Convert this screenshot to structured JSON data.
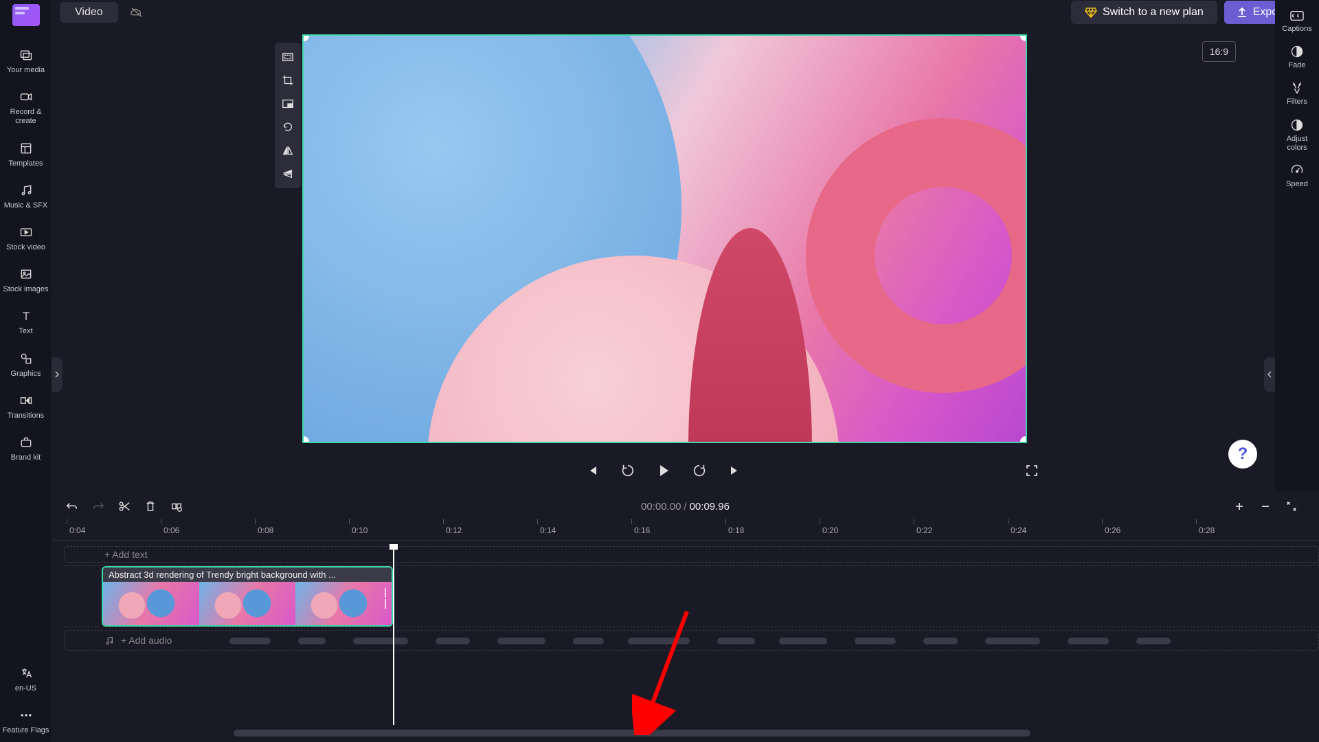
{
  "header": {
    "title_tab": "Video",
    "switch_plan": "Switch to a new plan",
    "export": "Export",
    "aspect_ratio": "16:9"
  },
  "left_sidebar": {
    "items": [
      {
        "label": "Your media",
        "icon": "media-icon"
      },
      {
        "label": "Record & create",
        "icon": "record-icon"
      },
      {
        "label": "Templates",
        "icon": "templates-icon"
      },
      {
        "label": "Music & SFX",
        "icon": "music-icon"
      },
      {
        "label": "Stock video",
        "icon": "stock-video-icon"
      },
      {
        "label": "Stock images",
        "icon": "stock-images-icon"
      },
      {
        "label": "Text",
        "icon": "text-icon"
      },
      {
        "label": "Graphics",
        "icon": "graphics-icon"
      },
      {
        "label": "Transitions",
        "icon": "transitions-icon"
      },
      {
        "label": "Brand kit",
        "icon": "brand-kit-icon"
      }
    ],
    "footer": [
      {
        "label": "en-US",
        "icon": "language-icon"
      },
      {
        "label": "Feature Flags",
        "icon": "more-icon"
      }
    ]
  },
  "right_sidebar": {
    "items": [
      {
        "label": "Captions",
        "icon": "captions-icon"
      },
      {
        "label": "Fade",
        "icon": "fade-icon"
      },
      {
        "label": "Filters",
        "icon": "filters-icon"
      },
      {
        "label": "Adjust colors",
        "icon": "adjust-icon"
      },
      {
        "label": "Speed",
        "icon": "speed-icon"
      }
    ]
  },
  "floating_tools": {
    "items": [
      {
        "name": "fit-icon"
      },
      {
        "name": "crop-icon"
      },
      {
        "name": "pip-icon"
      },
      {
        "name": "rotate-icon"
      },
      {
        "name": "flip-h-icon"
      },
      {
        "name": "flip-v-icon"
      }
    ]
  },
  "playback": {
    "current_time": "00:00.00",
    "total_time": "00:09.96"
  },
  "timeline": {
    "ruler": [
      "0:04",
      "0:06",
      "0:08",
      "0:10",
      "0:12",
      "0:14",
      "0:16",
      "0:18",
      "0:20",
      "0:22",
      "0:24",
      "0:26",
      "0:28"
    ],
    "text_track_placeholder": "+ Add text",
    "audio_track_placeholder": "+ Add audio",
    "clip_title": "Abstract 3d rendering of Trendy bright background with ..."
  },
  "help": "?"
}
